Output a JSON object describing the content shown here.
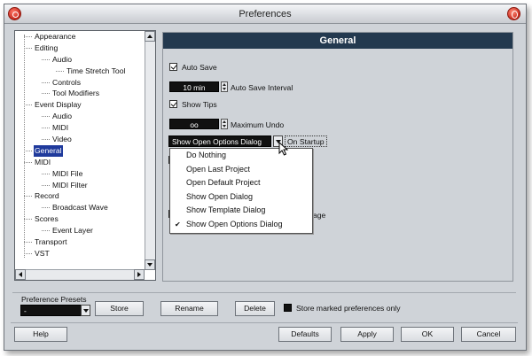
{
  "window": {
    "title": "Preferences"
  },
  "tree": {
    "items": [
      {
        "label": "Appearance",
        "level": 1
      },
      {
        "label": "Editing",
        "level": 1
      },
      {
        "label": "Audio",
        "level": 2
      },
      {
        "label": "Time Stretch Tool",
        "level": 3
      },
      {
        "label": "Controls",
        "level": 2
      },
      {
        "label": "Tool Modifiers",
        "level": 2
      },
      {
        "label": "Event Display",
        "level": 1
      },
      {
        "label": "Audio",
        "level": 2
      },
      {
        "label": "MIDI",
        "level": 2
      },
      {
        "label": "Video",
        "level": 2
      },
      {
        "label": "General",
        "level": 1,
        "selected": true
      },
      {
        "label": "MIDI",
        "level": 1
      },
      {
        "label": "MIDI File",
        "level": 2
      },
      {
        "label": "MIDI Filter",
        "level": 2
      },
      {
        "label": "Record",
        "level": 1
      },
      {
        "label": "Broadcast Wave",
        "level": 2
      },
      {
        "label": "Scores",
        "level": 1
      },
      {
        "label": "Event Layer",
        "level": 2
      },
      {
        "label": "Transport",
        "level": 1
      },
      {
        "label": "VST",
        "level": 1
      }
    ]
  },
  "panel": {
    "title": "General",
    "auto_save": {
      "label": "Auto Save",
      "checked": true
    },
    "auto_save_interval": {
      "value": "10 min",
      "label": "Auto Save Interval"
    },
    "show_tips": {
      "label": "Show Tips",
      "checked": true
    },
    "maximum_undo": {
      "value": "oo",
      "label": "Maximum Undo"
    },
    "startup": {
      "selected": "Show Open Options Dialog",
      "label": "On Startup",
      "options": [
        {
          "label": "Do Nothing",
          "checked": false
        },
        {
          "label": "Open Last Project",
          "checked": false
        },
        {
          "label": "Open Default Project",
          "checked": false
        },
        {
          "label": "Show Open Dialog",
          "checked": false
        },
        {
          "label": "Show Template Dialog",
          "checked": false
        },
        {
          "label": "Show Open Options Dialog",
          "checked": true
        }
      ]
    },
    "partial_text": "age"
  },
  "presets": {
    "label": "Preference Presets",
    "selected": "-",
    "store_label": "Store",
    "rename_label": "Rename",
    "delete_label": "Delete",
    "store_marked_label": "Store marked preferences only"
  },
  "footer": {
    "help_label": "Help",
    "defaults_label": "Defaults",
    "apply_label": "Apply",
    "ok_label": "OK",
    "cancel_label": "Cancel"
  },
  "colors": {
    "header_bg": "#23394f",
    "selection": "#1f3a9c",
    "window_bg": "#cfd3d8"
  }
}
